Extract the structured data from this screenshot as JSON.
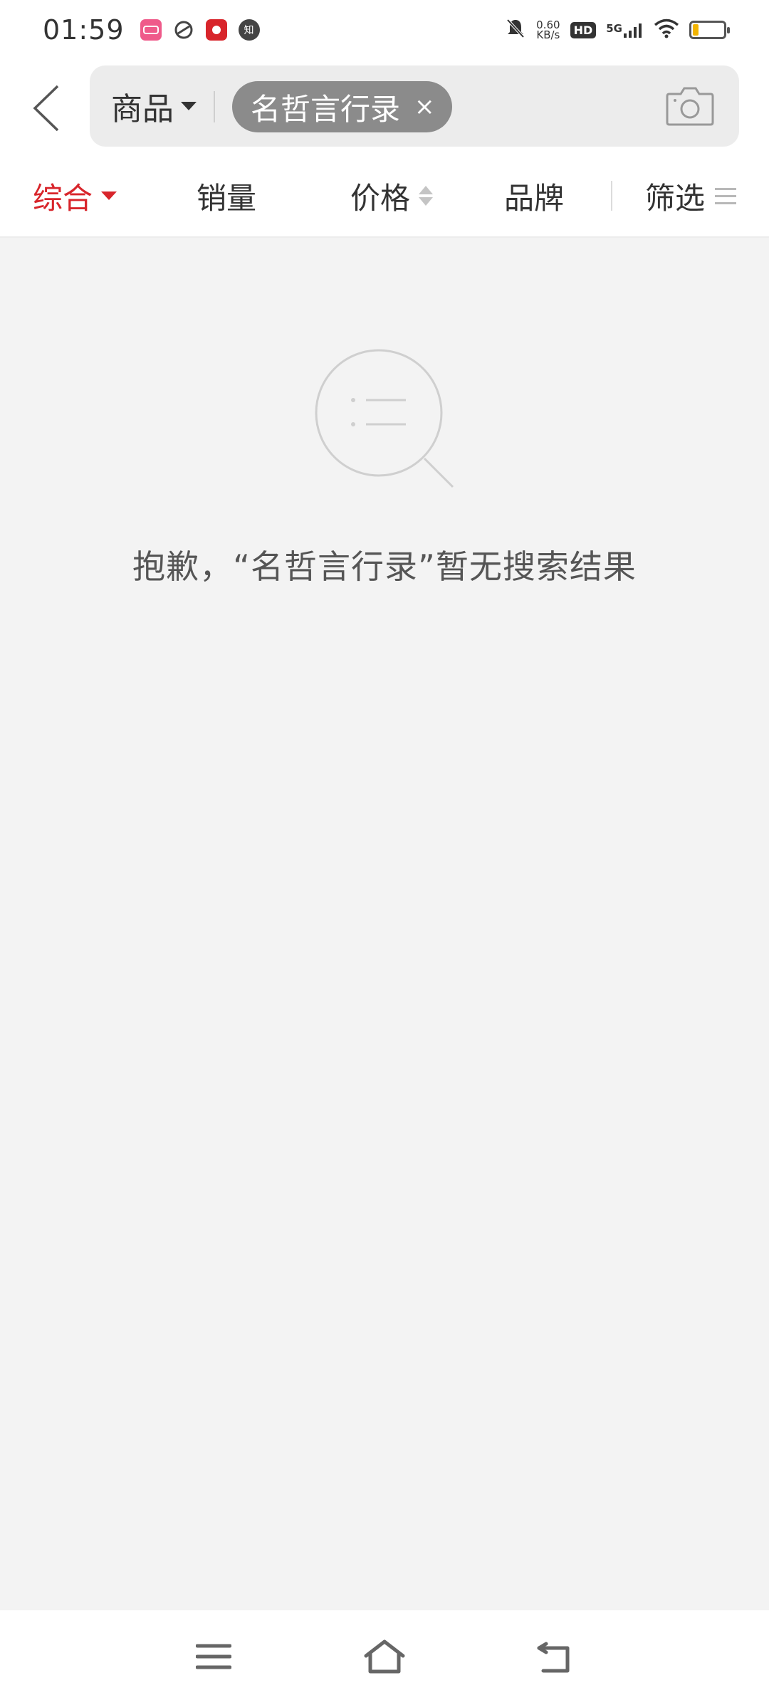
{
  "status_bar": {
    "time": "01:59",
    "net_speed_value": "0.60",
    "net_speed_unit": "KB/s",
    "hd_label": "HD",
    "network_label": "5G",
    "app_icons": [
      "lalala-app-icon",
      "swirl-app-icon",
      "red-app-icon",
      "zhihu-icon"
    ],
    "zhihu_char": "知"
  },
  "search": {
    "scope_label": "商品",
    "keyword": "名哲言行录",
    "close_glyph": "×"
  },
  "tabs": {
    "comprehensive": "综合",
    "sales": "销量",
    "price": "价格",
    "brand": "品牌",
    "filter": "筛选"
  },
  "empty_state": {
    "message": "抱歉，“名哲言行录”暂无搜索结果"
  },
  "colors": {
    "accent": "#d8252b",
    "chip_bg": "#8b8b8b",
    "page_bg": "#f3f3f3"
  }
}
